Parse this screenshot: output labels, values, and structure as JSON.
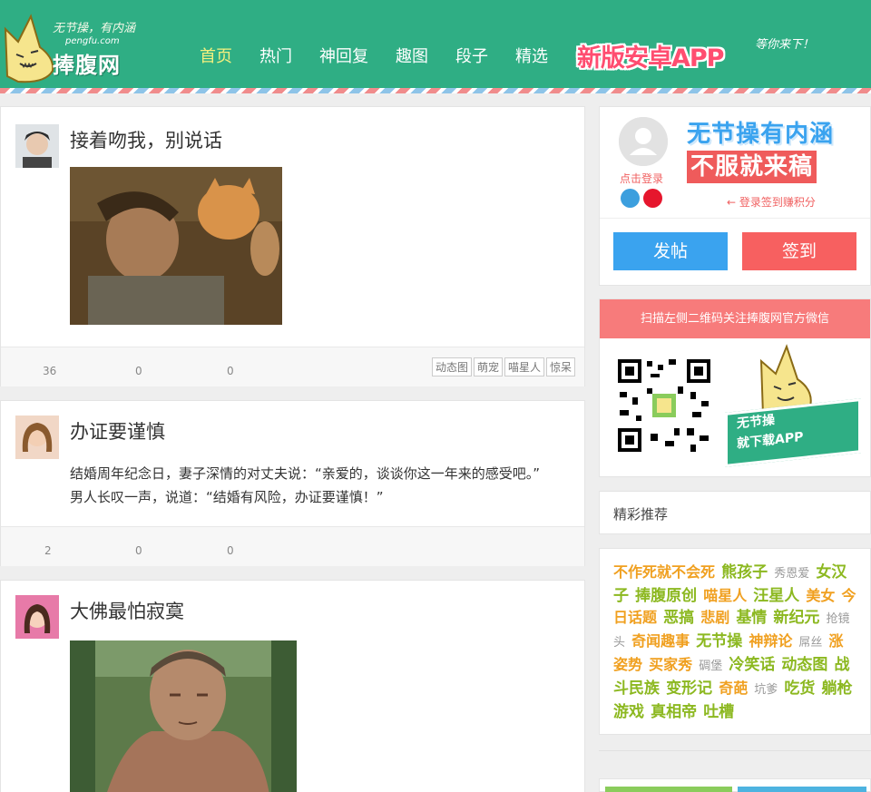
{
  "brand": {
    "slogan": "无节操，有内涵",
    "domain": "pengfu.com",
    "name": "捧腹网"
  },
  "nav": {
    "items": [
      {
        "label": "首页"
      },
      {
        "label": "热门"
      },
      {
        "label": "神回复"
      },
      {
        "label": "趣图"
      },
      {
        "label": "段子"
      },
      {
        "label": "精选"
      }
    ],
    "app_banner": "新版安卓APP",
    "app_sub": "等你来下！"
  },
  "posts": [
    {
      "title": "接着吻我，别说话",
      "counts": [
        "36",
        "0",
        "0"
      ],
      "tags": [
        "动态图",
        "萌宠",
        "喵星人",
        "惊呆"
      ]
    },
    {
      "title": "办证要谨慎",
      "text": "结婚周年纪念日，妻子深情的对丈夫说：“亲爱的，谈谈你这一年来的感受吧。”　　男人长叹一声，说道：“结婚有风险，办证要谨慎！”",
      "counts": [
        "2",
        "0",
        "0"
      ]
    },
    {
      "title": "大佛最怕寂寞"
    }
  ],
  "sidebar": {
    "login_label": "点击登录",
    "ad_line1": "无节操有内涵",
    "ad_line2": "不服就来稿",
    "signin_hint": "← 登录签到赚积分",
    "post_button": "发帖",
    "signin_button": "签到",
    "qr_header": "扫描左侧二维码关注捧腹网官方微信",
    "qr_line1": "无节操",
    "qr_line2": "就下载APP",
    "rec_title": "精彩推荐",
    "keywords": [
      {
        "text": "不作死就不会死",
        "color": "#f0a020",
        "size": "mid"
      },
      {
        "text": "熊孩子",
        "color": "#8cb820",
        "size": "big"
      },
      {
        "text": "秀恩爱",
        "color": "#999999",
        "size": "small"
      },
      {
        "text": "女汉子",
        "color": "#8cb820",
        "size": "big"
      },
      {
        "text": "捧腹原创",
        "color": "#8cb820",
        "size": "big"
      },
      {
        "text": "喵星人",
        "color": "#f0a020",
        "size": "mid"
      },
      {
        "text": "汪星人",
        "color": "#8cb820",
        "size": "big"
      },
      {
        "text": "美女",
        "color": "#f0a020",
        "size": "mid"
      },
      {
        "text": "今日话题",
        "color": "#f0a020",
        "size": "mid"
      },
      {
        "text": "恶搞",
        "color": "#8cb820",
        "size": "big"
      },
      {
        "text": "悲剧",
        "color": "#f0a020",
        "size": "mid"
      },
      {
        "text": "基情",
        "color": "#8cb820",
        "size": "big"
      },
      {
        "text": "新纪元",
        "color": "#8cb820",
        "size": "big"
      },
      {
        "text": "抢镜头",
        "color": "#999999",
        "size": "small"
      },
      {
        "text": "奇闻趣事",
        "color": "#f0a020",
        "size": "mid"
      },
      {
        "text": "无节操",
        "color": "#8cb820",
        "size": "big"
      },
      {
        "text": "神辩论",
        "color": "#f0a020",
        "size": "mid"
      },
      {
        "text": "屌丝",
        "color": "#999999",
        "size": "small"
      },
      {
        "text": "涨姿势",
        "color": "#f0a020",
        "size": "mid"
      },
      {
        "text": "买家秀",
        "color": "#f0a020",
        "size": "mid"
      },
      {
        "text": "碉堡",
        "color": "#999999",
        "size": "small"
      },
      {
        "text": "冷笑话",
        "color": "#8cb820",
        "size": "big"
      },
      {
        "text": "动态图",
        "color": "#8cb820",
        "size": "big"
      },
      {
        "text": "战斗民族",
        "color": "#8cb820",
        "size": "big"
      },
      {
        "text": "变形记",
        "color": "#8cb820",
        "size": "big"
      },
      {
        "text": "奇葩",
        "color": "#f0a020",
        "size": "mid"
      },
      {
        "text": "坑爹",
        "color": "#999999",
        "size": "small"
      },
      {
        "text": "吃货",
        "color": "#8cb820",
        "size": "big"
      },
      {
        "text": "躺枪",
        "color": "#8cb820",
        "size": "big"
      },
      {
        "text": "游戏",
        "color": "#8cb820",
        "size": "big"
      },
      {
        "text": "真相帝",
        "color": "#8cb820",
        "size": "big"
      },
      {
        "text": "吐槽",
        "color": "#8cb820",
        "size": "big"
      }
    ]
  },
  "colors": {
    "header_green": "#2fae84",
    "nav_active": "#f4f07e",
    "post_button": "#3aa3ef",
    "signin_button": "#f76060",
    "qr_header": "#f77b7b"
  }
}
